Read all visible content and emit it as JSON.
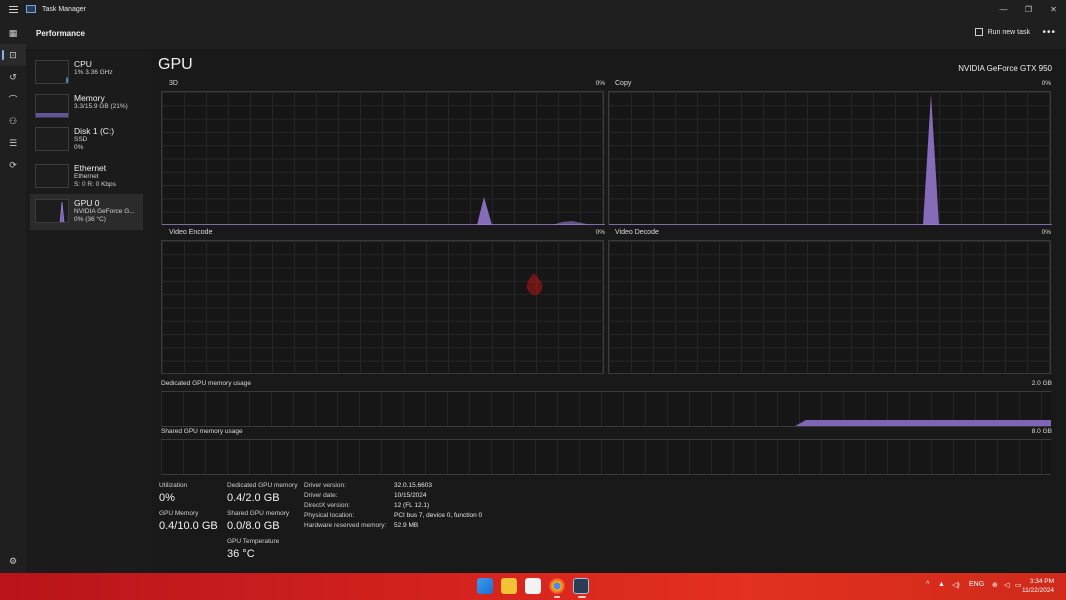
{
  "app": {
    "title": "Task Manager"
  },
  "window_controls": {
    "minimize": "—",
    "maximize": "❐",
    "close": "✕"
  },
  "header": {
    "title": "Performance",
    "run_new_task": "Run new task",
    "more": "•••"
  },
  "nav_icons": [
    "processes-icon",
    "performance-icon",
    "app-history-icon",
    "startup-apps-icon",
    "users-icon",
    "details-icon",
    "services-icon",
    "settings-icon"
  ],
  "devices": [
    {
      "name": "CPU",
      "sub1": "1%  3.36 GHz",
      "sub2": "",
      "sub3": ""
    },
    {
      "name": "Memory",
      "sub1": "3.3/15.9 GB (21%)",
      "sub2": "",
      "sub3": ""
    },
    {
      "name": "Disk 1 (C:)",
      "sub1": "SSD",
      "sub2": "0%",
      "sub3": ""
    },
    {
      "name": "Ethernet",
      "sub1": "Ethernet",
      "sub2": "S: 0 R: 0 Kbps",
      "sub3": ""
    },
    {
      "name": "GPU 0",
      "sub1": "NVIDIA GeForce G...",
      "sub2": "0%  (36 °C)",
      "sub3": ""
    }
  ],
  "gpu": {
    "title": "GPU",
    "model": "NVIDIA GeForce GTX 950",
    "engines": [
      {
        "label": "3D",
        "pct": "0%"
      },
      {
        "label": "Copy",
        "pct": "0%"
      },
      {
        "label": "Video Encode",
        "pct": "0%"
      },
      {
        "label": "Video Decode",
        "pct": "0%"
      }
    ],
    "dedicated": {
      "label": "Dedicated GPU memory usage",
      "max": "2.0 GB"
    },
    "shared": {
      "label": "Shared GPU memory usage",
      "max": "8.0 GB"
    },
    "accent_color": "#9a7ad6"
  },
  "stats": {
    "utilization_label": "Utilization",
    "utilization": "0%",
    "gpu_memory_label": "GPU Memory",
    "gpu_memory": "0.4/10.0 GB",
    "dedicated_label": "Dedicated GPU memory",
    "dedicated": "0.4/2.0 GB",
    "shared_label": "Shared GPU memory",
    "shared": "0.0/8.0 GB",
    "temp_label": "GPU Temperature",
    "temp": "36 °C"
  },
  "info": [
    {
      "k": "Driver version:",
      "v": "32.0.15.6603"
    },
    {
      "k": "Driver date:",
      "v": "10/15/2024"
    },
    {
      "k": "DirectX version:",
      "v": "12 (FL 12.1)"
    },
    {
      "k": "Physical location:",
      "v": "PCI bus 7, device 0, function 0"
    },
    {
      "k": "Hardware reserved memory:",
      "v": "52.9 MB"
    }
  ],
  "taskbar": {
    "language": "ENG",
    "time": "3:34 PM",
    "date": "11/22/2024",
    "tray_up": "^"
  }
}
